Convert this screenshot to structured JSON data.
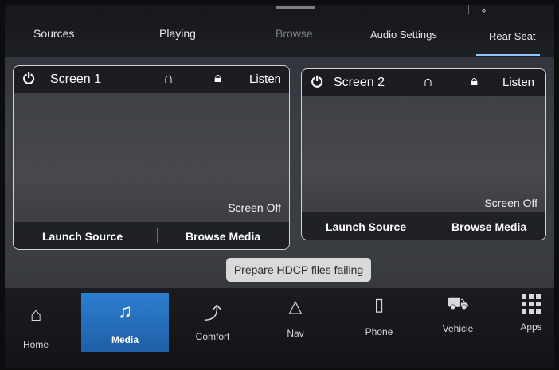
{
  "top_tabs": {
    "sources": "Sources",
    "playing": "Playing",
    "browse": "Browse",
    "audio_settings": "Audio Settings",
    "rear_seat": "Rear Seat"
  },
  "screens": [
    {
      "title": "Screen 1",
      "listen": "Listen",
      "status": "Screen Off",
      "launch_source": "Launch Source",
      "browse_media": "Browse Media"
    },
    {
      "title": "Screen 2",
      "listen": "Listen",
      "status": "Screen Off",
      "launch_source": "Launch Source",
      "browse_media": "Browse Media"
    }
  ],
  "toast": "Prepare HDCP files failing",
  "nav": {
    "home": "Home",
    "media": "Media",
    "comfort": "Comfort",
    "nav": "Nav",
    "phone": "Phone",
    "vehicle": "Vehicle",
    "apps": "Apps"
  },
  "colors": {
    "accent": "#2c7fcf",
    "tab_underline": "#8ec6ff",
    "toast_bg": "#d9d9d9"
  },
  "icons": {
    "power": "power-icon",
    "headphones": "headphones-icon",
    "lock": "lock-icon",
    "home": "home-icon",
    "music": "music-note-icon",
    "seat": "seat-icon",
    "nav": "navigation-arrow-icon",
    "phone": "phone-icon",
    "vehicle": "car-icon",
    "apps": "apps-grid-icon",
    "mic": "microphone-icon"
  }
}
